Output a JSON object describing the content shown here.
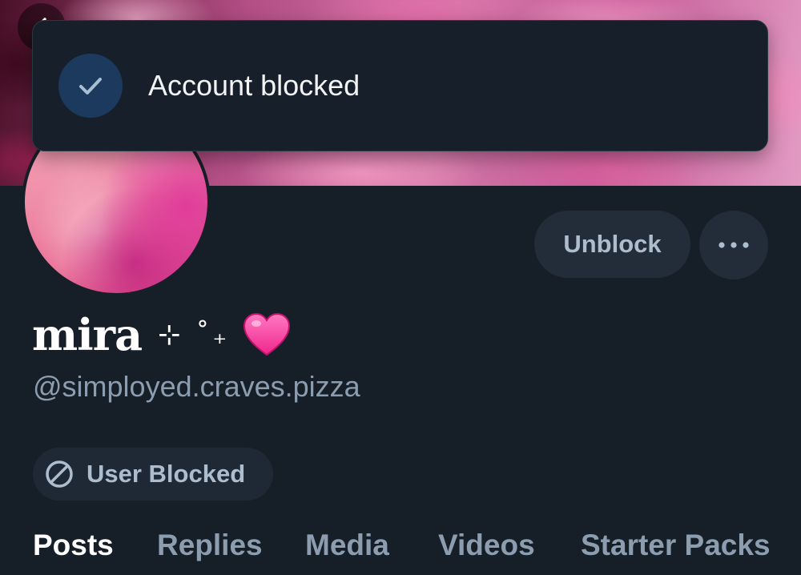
{
  "toast": {
    "message": "Account blocked",
    "icon": "check-icon"
  },
  "profile": {
    "display_name": "mira",
    "name_decoration": "⊹ ˚₊",
    "name_emoji": "heart-icon",
    "handle": "@simployed.craves.pizza"
  },
  "actions": {
    "unblock_label": "Unblock",
    "more_icon": "ellipsis-icon"
  },
  "status": {
    "blocked_label": "User Blocked",
    "icon": "block-icon"
  },
  "tabs": [
    {
      "label": "Posts",
      "active": true
    },
    {
      "label": "Replies",
      "active": false
    },
    {
      "label": "Media",
      "active": false
    },
    {
      "label": "Videos",
      "active": false
    },
    {
      "label": "Starter Packs",
      "active": false
    }
  ],
  "colors": {
    "background": "#161e27",
    "toast_icon_bg": "#1c3a5e",
    "button_bg": "#222d39",
    "muted_text": "#8d9db0",
    "heart": "#ff3fa4"
  }
}
